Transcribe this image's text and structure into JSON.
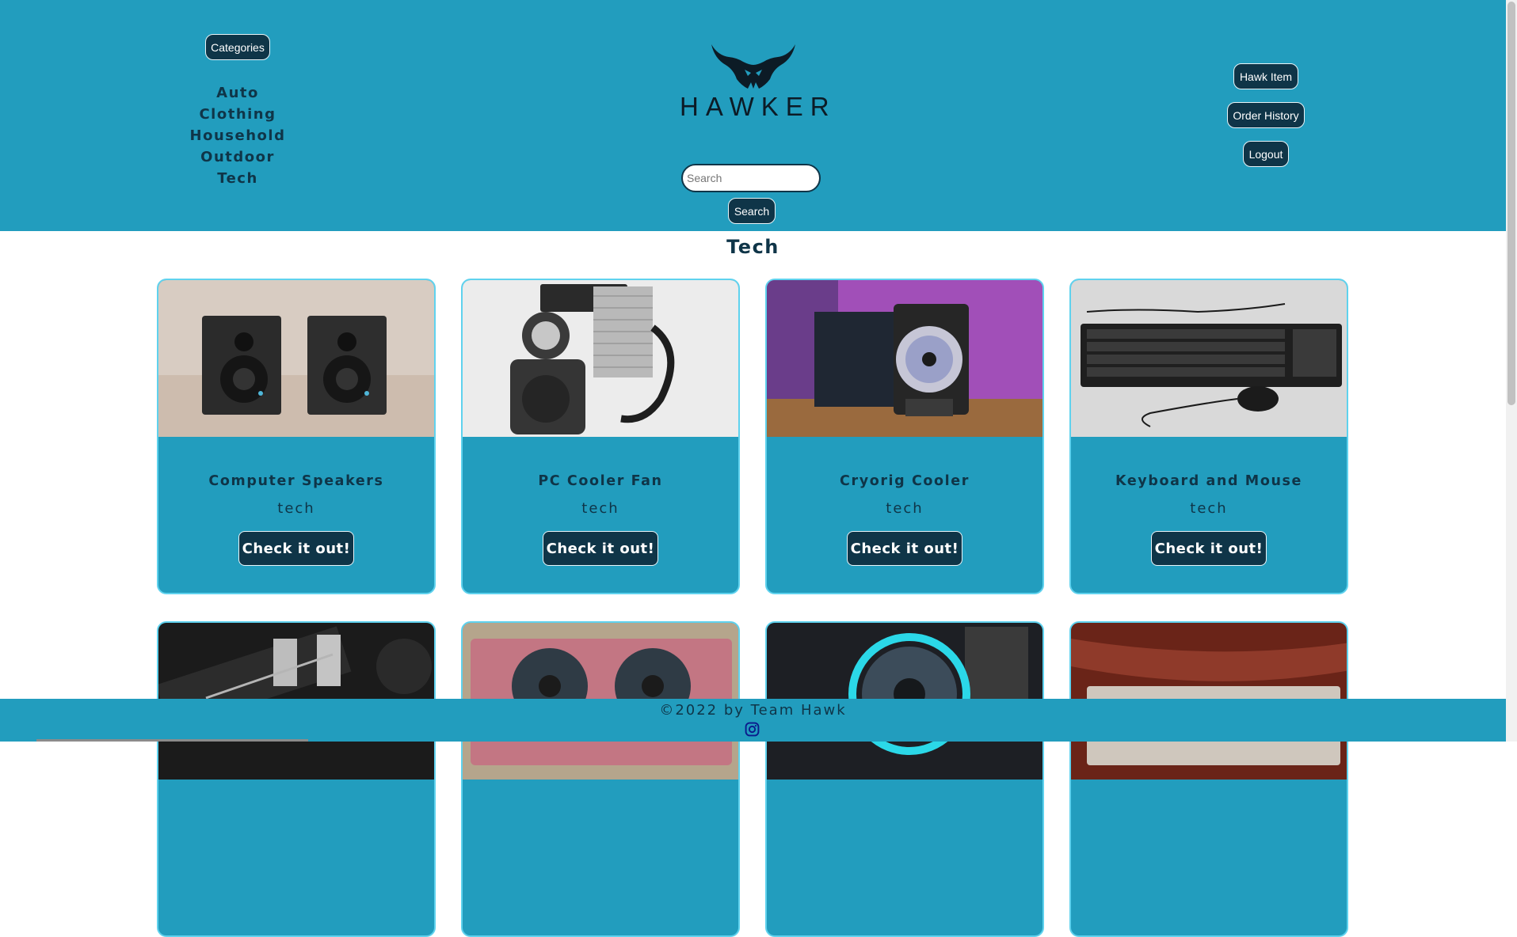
{
  "header": {
    "categories_button": "Categories",
    "categories": [
      "Auto",
      "Clothing",
      "Household",
      "Outdoor",
      "Tech"
    ],
    "logo_text": "HAWKER",
    "search_placeholder": "Search",
    "search_button": "Search",
    "actions": [
      "Hawk Item",
      "Order History",
      "Logout"
    ]
  },
  "main": {
    "title": "Tech",
    "cards": [
      {
        "title": "Computer Speakers",
        "category": "tech",
        "cta": "Check it out!"
      },
      {
        "title": "PC Cooler Fan",
        "category": "tech",
        "cta": "Check it out!"
      },
      {
        "title": "Cryorig Cooler",
        "category": "tech",
        "cta": "Check it out!"
      },
      {
        "title": "Keyboard and Mouse",
        "category": "tech",
        "cta": "Check it out!"
      }
    ]
  },
  "footer": {
    "copyright": "©2022 by Team Hawk",
    "social_icon": "instagram-icon"
  },
  "colors": {
    "header_bg": "#229dbe",
    "button_bg": "#0f3548",
    "card_border": "#5fd2ee",
    "text_dark": "#0f3548"
  }
}
